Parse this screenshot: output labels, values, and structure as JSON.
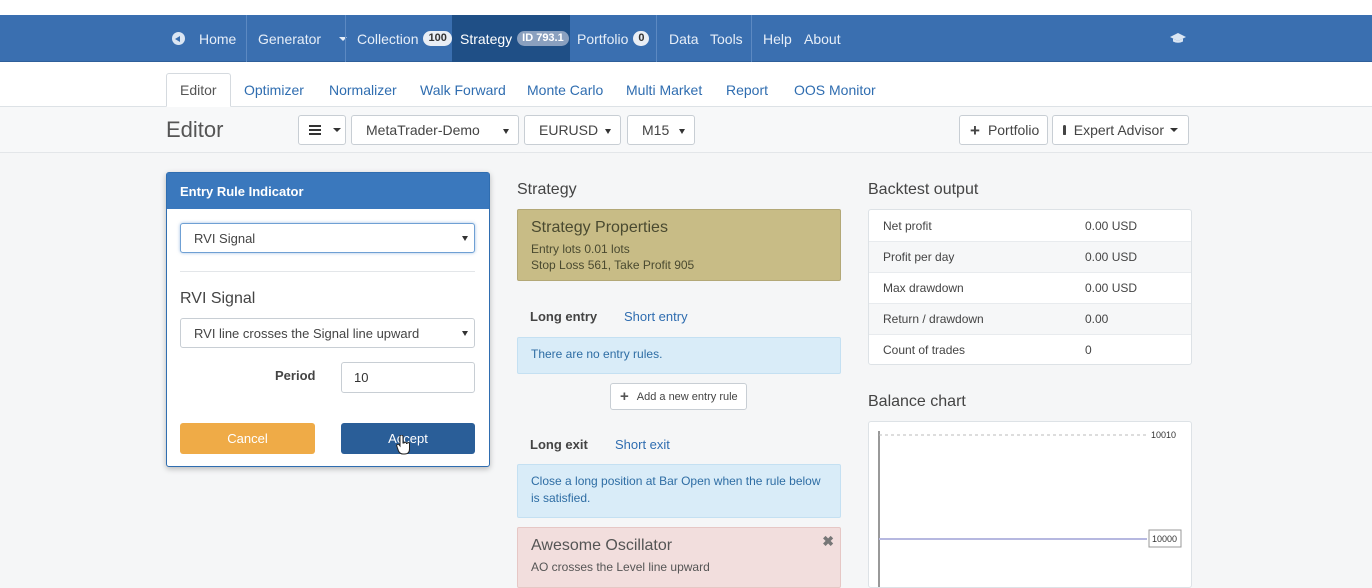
{
  "nav": {
    "home": "Home",
    "generator": "Generator",
    "collection": "Collection",
    "collection_count": "100",
    "strategy": "Strategy",
    "strategy_id": "ID 793.1",
    "portfolio": "Portfolio",
    "portfolio_count": "0",
    "data": "Data",
    "tools": "Tools",
    "help": "Help",
    "about": "About"
  },
  "tabs": [
    "Editor",
    "Optimizer",
    "Normalizer",
    "Walk Forward",
    "Monte Carlo",
    "Multi Market",
    "Report",
    "OOS Monitor"
  ],
  "toolbar": {
    "title": "Editor",
    "server": "MetaTrader-Demo",
    "symbol": "EURUSD",
    "period": "M15",
    "portfolio_btn": "Portfolio",
    "ea_btn": "Expert Advisor"
  },
  "dialog": {
    "title": "Entry Rule Indicator",
    "indicator_select": "RVI Signal",
    "indicator_title": "RVI Signal",
    "logic_select": "RVI line crosses the Signal line upward",
    "period_label": "Period",
    "period_value": "10",
    "cancel": "Cancel",
    "accept": "Accept"
  },
  "strategy": {
    "title": "Strategy",
    "props_title": "Strategy Properties",
    "props_line1": "Entry lots 0.01 lots",
    "props_line2": "Stop Loss 561, Take Profit 905",
    "long_entry": "Long entry",
    "short_entry": "Short entry",
    "no_rules": "There are no entry rules.",
    "add_rule": "Add a new entry rule",
    "long_exit": "Long exit",
    "short_exit": "Short exit",
    "exit_info": "Close a long position at Bar Open when the rule below is satisfied.",
    "rule_title": "Awesome Oscillator",
    "rule_desc": "AO crosses the Level line upward"
  },
  "backtest": {
    "title": "Backtest output",
    "rows": [
      {
        "k": "Net profit",
        "v": "0.00 USD"
      },
      {
        "k": "Profit per day",
        "v": "0.00 USD"
      },
      {
        "k": "Max drawdown",
        "v": "0.00 USD"
      },
      {
        "k": "Return / drawdown",
        "v": "0.00"
      },
      {
        "k": "Count of trades",
        "v": "0"
      }
    ]
  },
  "balance": {
    "title": "Balance chart",
    "top_label": "10010",
    "value_label": "10000",
    "ylim": [
      10000,
      10010
    ],
    "balance_value": 10000,
    "line_color": "#b6b8e0"
  },
  "colors": {
    "navbar": "#3a6fb0",
    "active_nav": "#1f4f86",
    "cancel": "#efab47",
    "accept": "#2a5e98",
    "properties": "#c8bc86",
    "rule": "#f2dedd",
    "info": "#d9ecf8"
  }
}
